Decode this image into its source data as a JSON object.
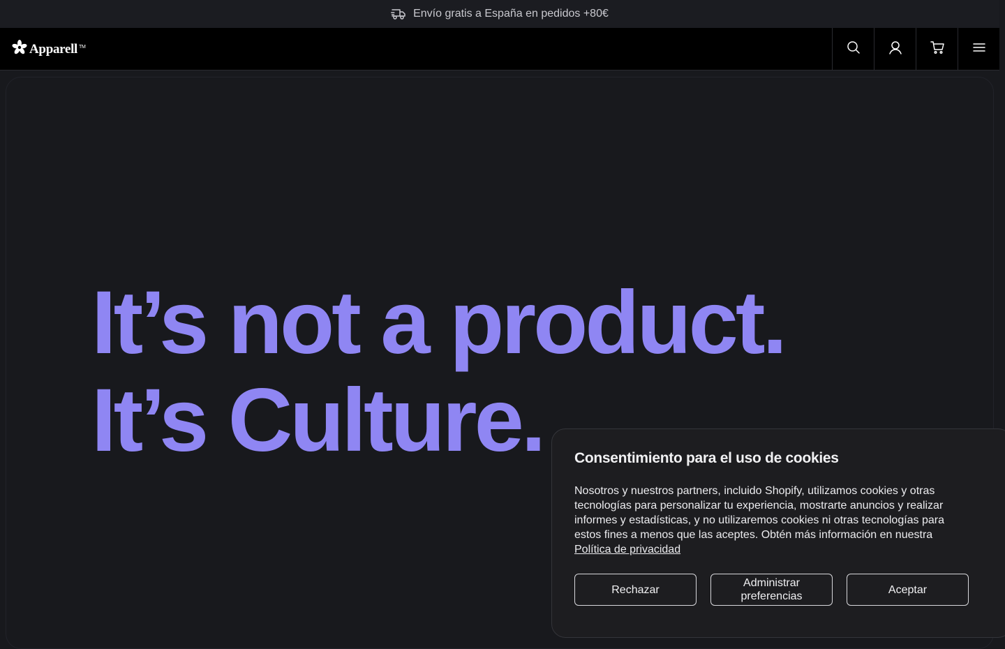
{
  "announcement": {
    "icon": "delivery-truck-icon",
    "text": "Envío gratis a España en pedidos +80€"
  },
  "header": {
    "logo_text": "Apparell",
    "logo_tm": "TM",
    "nav": [
      {
        "icon": "search-icon"
      },
      {
        "icon": "user-icon"
      },
      {
        "icon": "cart-icon"
      },
      {
        "icon": "menu-icon"
      }
    ]
  },
  "hero": {
    "line1": "It’s not a product.",
    "line2": "It’s Culture.",
    "accent_color": "#8f86f3"
  },
  "cookie_banner": {
    "title": "Consentimiento para el uso de cookies",
    "body": "Nosotros y nuestros partners, incluido Shopify, utilizamos cookies y otras tecnologías para personalizar tu experiencia, mostrarte anuncios y realizar informes y estadísticas, y no utilizaremos cookies ni otras tecnologías para estos fines a menos que las aceptes. Obtén más información en nuestra",
    "link_text": "Política de privacidad",
    "buttons": {
      "reject": "Rechazar",
      "manage": "Administrar preferencias",
      "accept": "Aceptar"
    }
  },
  "colors": {
    "background": "#18191d",
    "header": "#000000",
    "announcement_bar": "#1b1c21",
    "cookie_panel": "#1d1d20"
  }
}
